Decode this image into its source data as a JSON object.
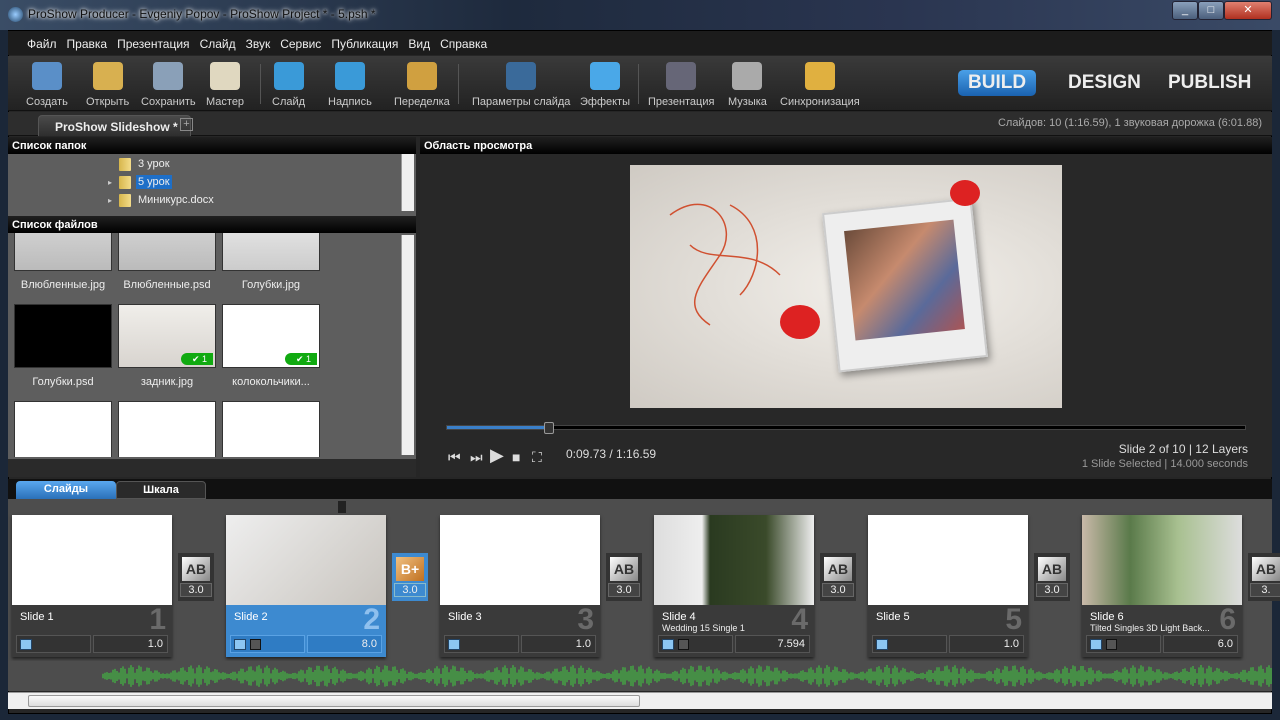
{
  "window": {
    "title": "ProShow Producer - Evgeniy Popov - ProShow Project * - 5.psh *"
  },
  "menu": [
    "Файл",
    "Правка",
    "Презентация",
    "Слайд",
    "Звук",
    "Сервис",
    "Публикация",
    "Вид",
    "Справка"
  ],
  "toolbar": [
    {
      "label": "Создать",
      "icon": "new-project-icon"
    },
    {
      "label": "Открыть",
      "icon": "open-folder-icon"
    },
    {
      "label": "Сохранить",
      "icon": "save-icon"
    },
    {
      "label": "Мастер",
      "icon": "wizard-icon"
    },
    {
      "label": "Слайд",
      "icon": "add-slide-icon"
    },
    {
      "label": "Надпись",
      "icon": "add-caption-icon"
    },
    {
      "label": "Переделка",
      "icon": "remix-icon"
    },
    {
      "label": "Параметры слайда",
      "icon": "slide-options-icon"
    },
    {
      "label": "Эффекты",
      "icon": "effects-icon"
    },
    {
      "label": "Презентация",
      "icon": "show-options-icon"
    },
    {
      "label": "Музыка",
      "icon": "music-icon"
    },
    {
      "label": "Синхронизация",
      "icon": "sync-icon"
    }
  ],
  "modes": [
    "BUILD",
    "DESIGN",
    "PUBLISH"
  ],
  "project_tab": "ProShow Slideshow *",
  "status": "Слайдов: 10 (1:16.59), 1 звуковая дорожка (6:01.88)",
  "folders": {
    "title": "Список папок",
    "items": [
      {
        "name": "3 урок",
        "selected": false
      },
      {
        "name": "5 урок",
        "selected": true
      },
      {
        "name": "Миникурс.docx",
        "selected": false
      }
    ]
  },
  "files": {
    "title": "Список файлов",
    "items": [
      {
        "name": "Влюбленные.jpg"
      },
      {
        "name": "Влюбленные.psd"
      },
      {
        "name": "Голубки.jpg"
      },
      {
        "name": "Голубки.psd"
      },
      {
        "name": "задник.jpg",
        "badge": "1"
      },
      {
        "name": "колокольчики...",
        "badge": "1"
      },
      {
        "name": ""
      },
      {
        "name": ""
      },
      {
        "name": ""
      }
    ]
  },
  "preview": {
    "title": "Область просмотра",
    "time": "0:09.73 / 1:16.59",
    "progress_fraction": 0.127,
    "slide_info": "Slide 2 of 10  |  12 Layers",
    "selection_info": "1 Slide Selected  |  14.000 seconds"
  },
  "bottom_tabs": [
    "Слайды",
    "Шкала"
  ],
  "slides": [
    {
      "name": "Slide 1",
      "sub": "",
      "num": "1",
      "duration": "1.0",
      "transition": "3.0"
    },
    {
      "name": "Slide 2",
      "sub": "",
      "num": "2",
      "duration": "8.0",
      "transition": "3.0",
      "selected": true
    },
    {
      "name": "Slide 3",
      "sub": "",
      "num": "3",
      "duration": "1.0",
      "transition": "3.0"
    },
    {
      "name": "Slide 4",
      "sub": "Wedding 15 Single 1",
      "num": "4",
      "duration": "7.594",
      "transition": "3.0"
    },
    {
      "name": "Slide 5",
      "sub": "",
      "num": "5",
      "duration": "1.0",
      "transition": "3.0"
    },
    {
      "name": "Slide 6",
      "sub": "Tilted Singles 3D Light Back...",
      "num": "6",
      "duration": "6.0",
      "transition": "3."
    }
  ],
  "colors": {
    "accent": "#3d8ad0",
    "waveform": "#3ecf3e"
  }
}
